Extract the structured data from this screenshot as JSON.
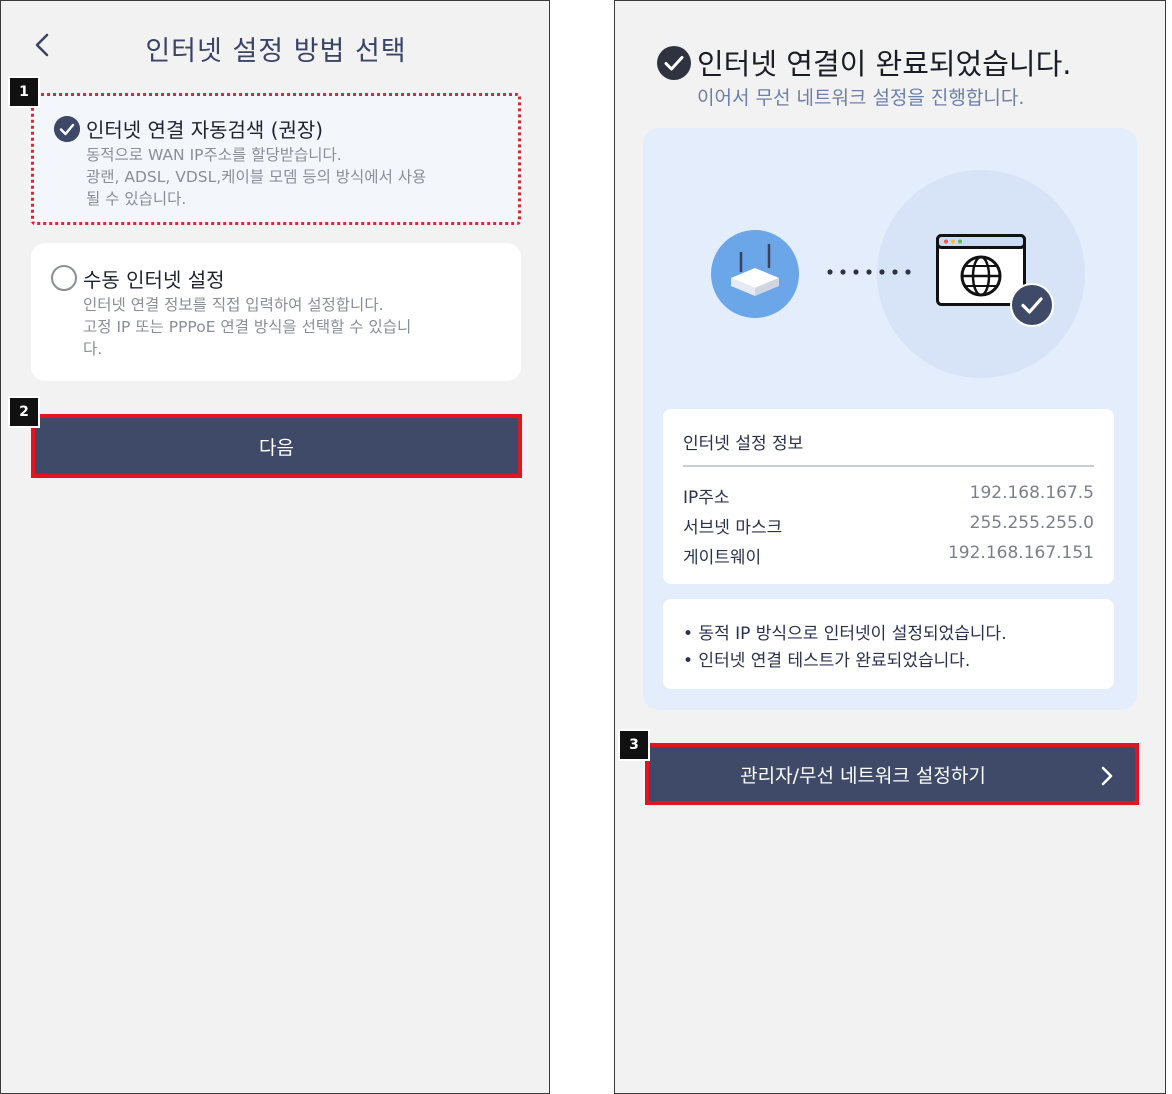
{
  "left_screen": {
    "title": "인터넷 설정 방법 선택",
    "options": [
      {
        "title": "인터넷 연결 자동검색 (권장)",
        "description": "동적으로 WAN IP주소를 할당받습니다.\n광랜, ADSL, VDSL,케이블 모뎀 등의 방식에서 사용\n될 수 있습니다.",
        "selected": true
      },
      {
        "title": "수동 인터넷 설정",
        "description": "인터넷 연결 정보를 직접 입력하여 설정합니다.\n고정 IP 또는 PPPoE 연결 방식을 선택할 수 있습니\n다.",
        "selected": false
      }
    ],
    "next_label": "다음"
  },
  "right_screen": {
    "title": "인터넷 연결이 완료되었습니다.",
    "subtitle": "이어서 무선 네트워크 설정을 진행합니다.",
    "settings": {
      "title": "인터넷 설정 정보",
      "rows": [
        {
          "label": "IP주소",
          "value": "192.168.167.5"
        },
        {
          "label": "서브넷 마스크",
          "value": "255.255.255.0"
        },
        {
          "label": "게이트웨이",
          "value": "192.168.167.151"
        }
      ]
    },
    "notes": [
      "• 동적 IP 방식으로 인터넷이 설정되었습니다.",
      "• 인터넷 연결 테스트가 완료되었습니다."
    ],
    "action_label": "관리자/무선 네트워크 설정하기"
  },
  "step_badges": [
    "1",
    "2",
    "3"
  ],
  "colors": {
    "primary": "#3f4a69",
    "highlight": "#e01520",
    "panel": "#e4edfb",
    "router": "#6aa6e8"
  },
  "icons": [
    "back-arrow-icon",
    "check-circle-icon",
    "radio-empty-icon",
    "router-icon",
    "browser-globe-icon",
    "check-badge-icon",
    "chevron-right-icon"
  ]
}
